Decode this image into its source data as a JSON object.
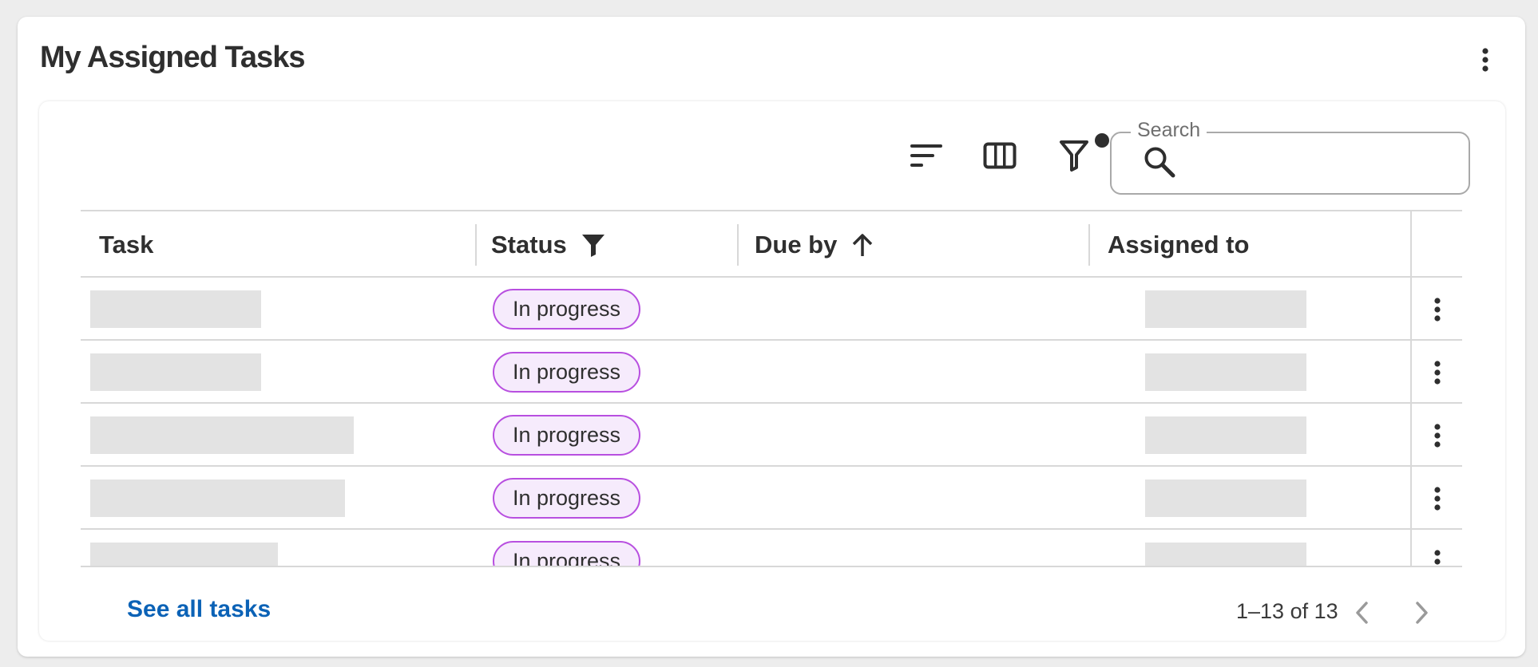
{
  "widget": {
    "title": "My Assigned Tasks",
    "menu_icon": "more-vertical-icon"
  },
  "toolbar": {
    "sort_icon": "sort-icon",
    "columns_icon": "columns-icon",
    "filter_icon": "filter-icon",
    "filter_active": true,
    "search": {
      "label": "Search",
      "value": "",
      "icon": "search-icon"
    }
  },
  "table": {
    "columns": [
      {
        "label": "Task",
        "icon": ""
      },
      {
        "label": "Status",
        "icon": "filter-icon"
      },
      {
        "label": "Due by",
        "icon": "arrow-up-icon"
      },
      {
        "label": "Assigned to",
        "icon": ""
      }
    ],
    "rows": [
      {
        "task": "",
        "status": "In progress",
        "due_by": "",
        "assigned_to": ""
      },
      {
        "task": "",
        "status": "In progress",
        "due_by": "",
        "assigned_to": ""
      },
      {
        "task": "",
        "status": "In progress",
        "due_by": "",
        "assigned_to": ""
      },
      {
        "task": "",
        "status": "In progress",
        "due_by": "",
        "assigned_to": ""
      },
      {
        "task": "",
        "status": "In progress",
        "due_by": "",
        "assigned_to": ""
      }
    ],
    "row_menu_icon": "more-vertical-icon"
  },
  "footer": {
    "link_label": "See all tasks",
    "pagination": "1–13 of 13",
    "prev_icon": "chevron-left-icon",
    "next_icon": "chevron-right-icon"
  },
  "colors": {
    "link": "#0b62b6",
    "chip_border": "#b84fe0",
    "chip_bg": "#f6ebfc",
    "skeleton": "#e3e3e3"
  }
}
